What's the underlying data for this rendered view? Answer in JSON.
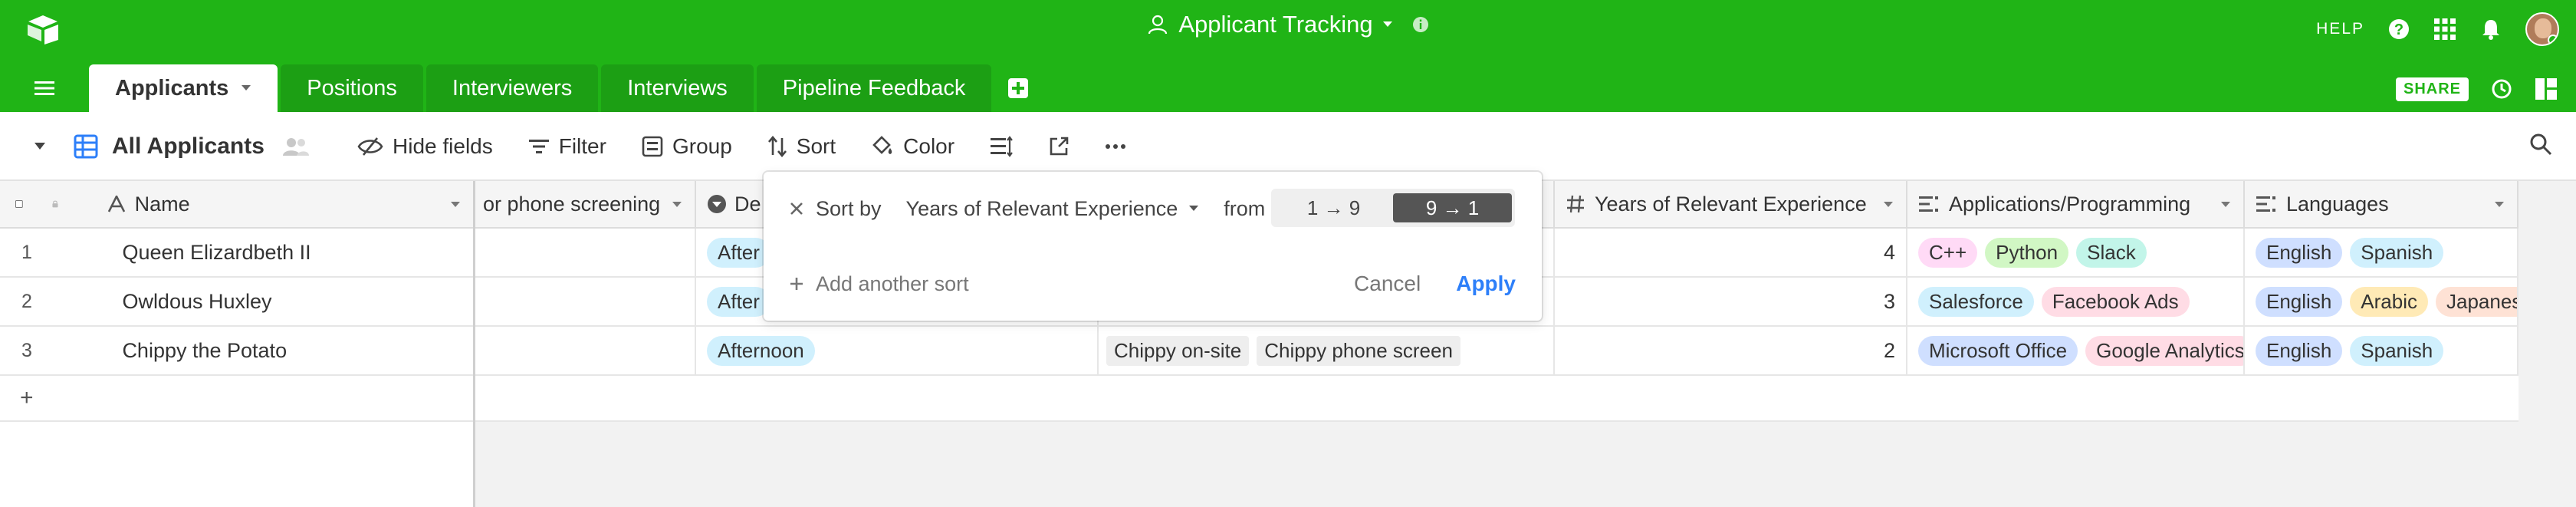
{
  "app": {
    "base_title": "Applicant Tracking",
    "help_label": "HELP",
    "share_label": "SHARE"
  },
  "tabs": [
    {
      "label": "Applicants",
      "active": true
    },
    {
      "label": "Positions"
    },
    {
      "label": "Interviewers"
    },
    {
      "label": "Interviews"
    },
    {
      "label": "Pipeline Feedback"
    }
  ],
  "toolbar": {
    "view_name": "All Applicants",
    "hide_fields": "Hide fields",
    "filter": "Filter",
    "group": "Group",
    "sort": "Sort",
    "color": "Color"
  },
  "columns": {
    "name": "Name",
    "phone_screening": "or phone screening",
    "desired": "De",
    "years": "Years of Relevant Experience",
    "apps": "Applications/Programming",
    "languages": "Languages"
  },
  "rows": [
    {
      "num": "1",
      "name": "Queen Elizardbeth II",
      "desired": "After",
      "interviews": [],
      "years": "4",
      "apps": [
        "C++",
        "Python",
        "Slack"
      ],
      "languages": [
        "English",
        "Spanish"
      ]
    },
    {
      "num": "2",
      "name": "Owldous Huxley",
      "desired": "After",
      "interviews": [],
      "years": "3",
      "apps": [
        "Salesforce",
        "Facebook Ads"
      ],
      "languages": [
        "English",
        "Arabic",
        "Japanese"
      ]
    },
    {
      "num": "3",
      "name": "Chippy the Potato",
      "desired": "Afternoon",
      "interviews": [
        "Chippy on-site",
        "Chippy phone screen"
      ],
      "years": "2",
      "apps": [
        "Microsoft Office",
        "Google Analytics"
      ],
      "languages": [
        "English",
        "Spanish"
      ]
    }
  ],
  "add_row_label": "+",
  "sort_popup": {
    "sort_by_label": "Sort by",
    "field": "Years of Relevant Experience",
    "from_label": "from",
    "asc_label": "1 → 9",
    "desc_label": "9 → 1",
    "selected": "desc",
    "add_another": "Add another sort",
    "cancel": "Cancel",
    "apply": "Apply"
  },
  "colors": {
    "brand_green": "#20b416",
    "apply_blue": "#2d7ff9"
  },
  "pill_colors": {
    "Afternoon": "#d0f0fd",
    "After": "#d0f0fd",
    "C++": "#ffdaf6",
    "Python": "#d1f7c4",
    "Slack": "#c2f5e9",
    "Salesforce": "#d0f0fd",
    "Facebook Ads": "#ffdce5",
    "Microsoft Office": "#cfdfff",
    "Google Analytics": "#ffdce5",
    "English": "#cfdfff",
    "Spanish": "#d0f0fd",
    "Arabic": "#ffeab6",
    "Japanese": "#fee2d5"
  }
}
